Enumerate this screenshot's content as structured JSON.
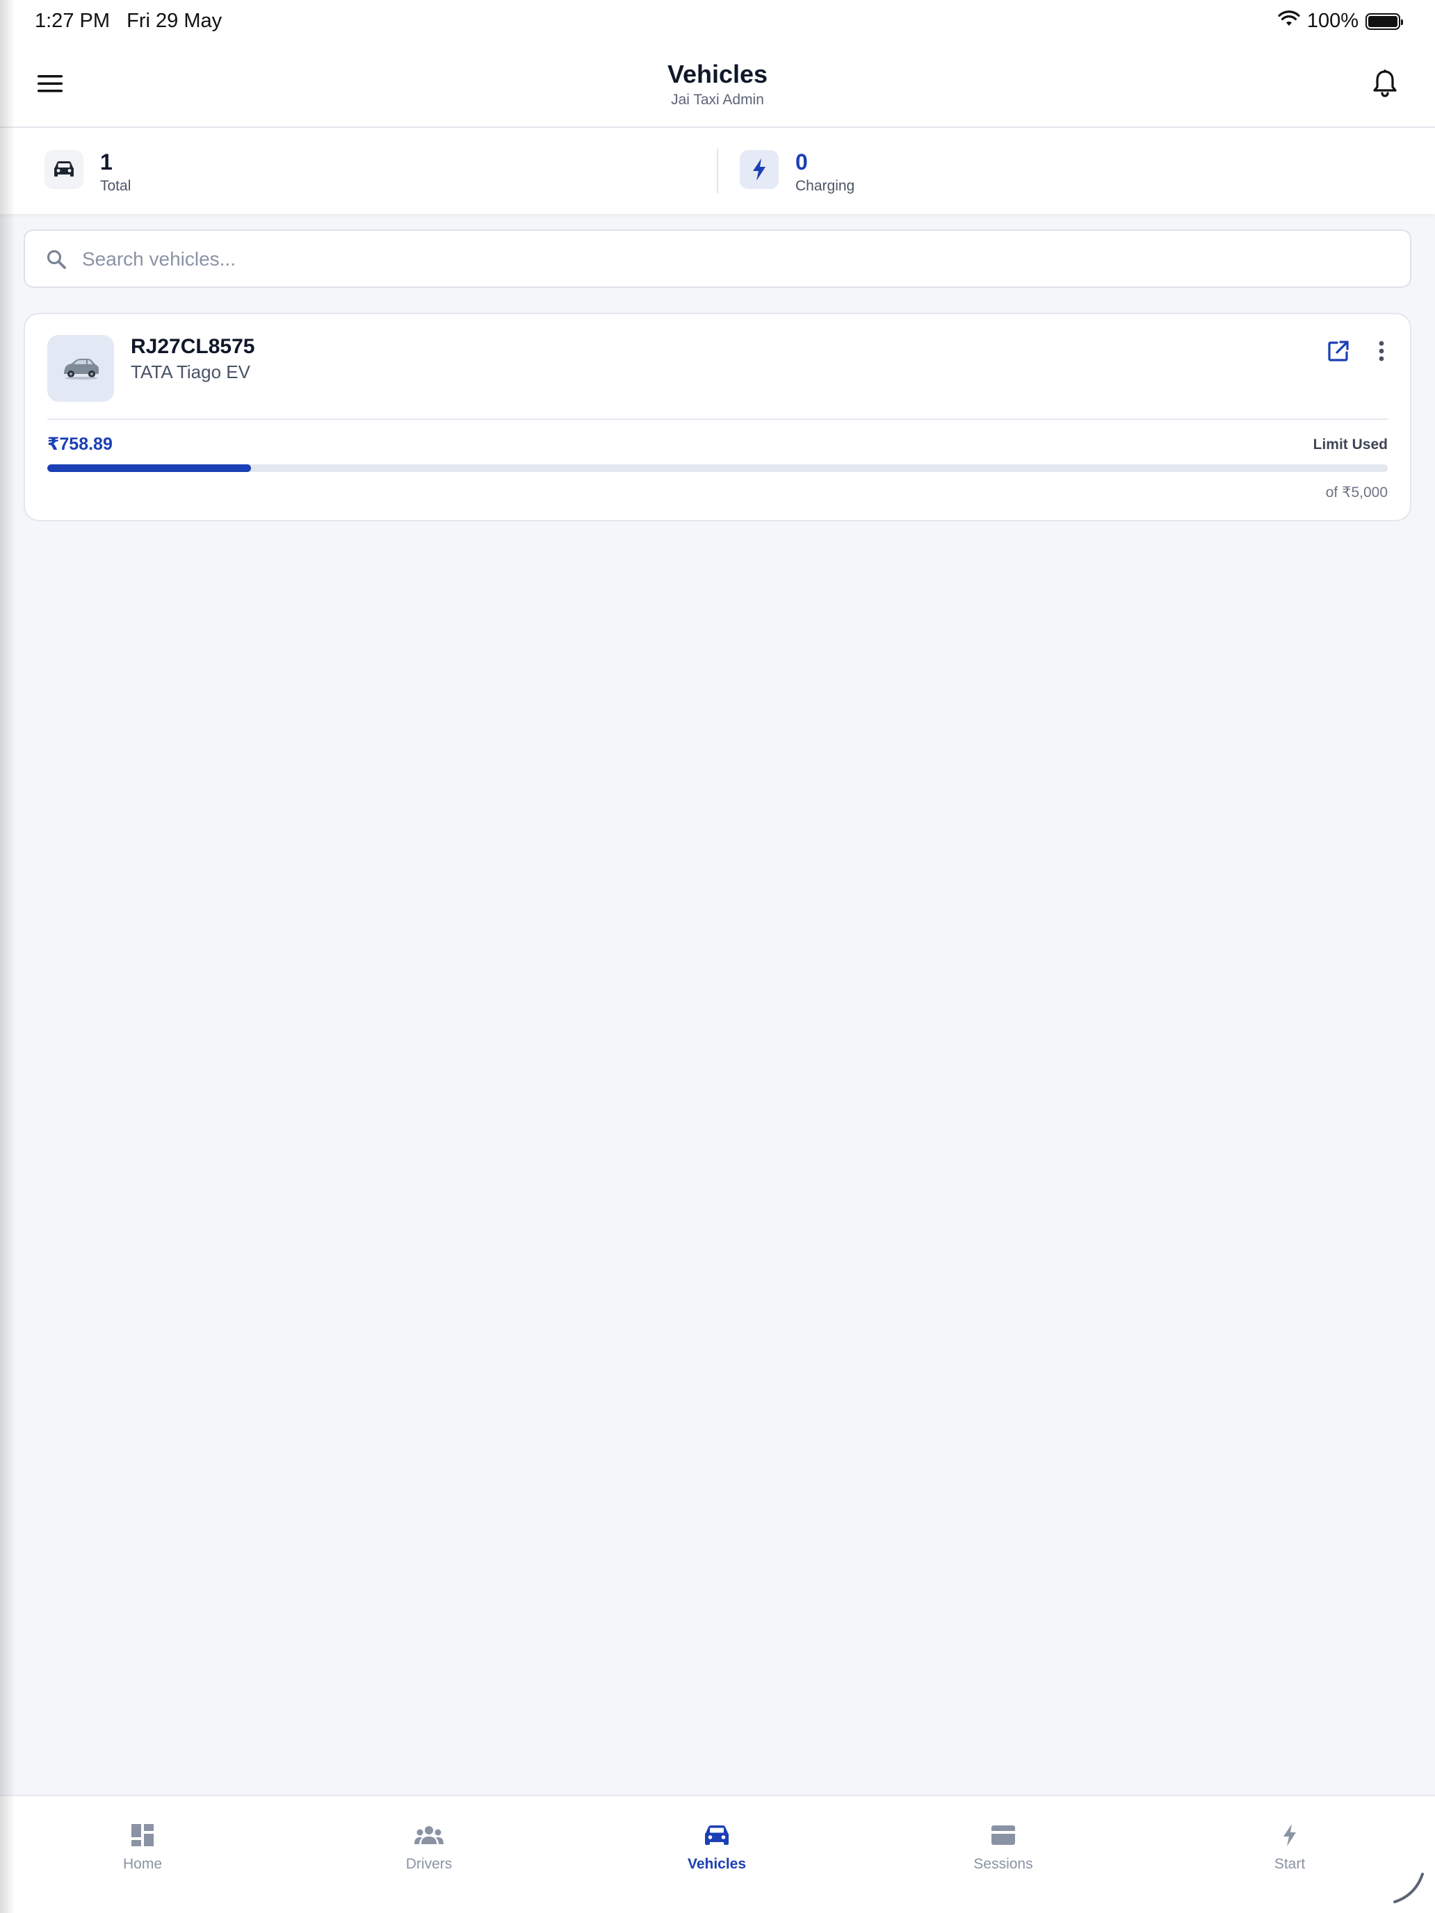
{
  "status_bar": {
    "time": "1:27 PM",
    "date": "Fri 29 May",
    "battery": "100%"
  },
  "header": {
    "title": "Vehicles",
    "subtitle": "Jai Taxi Admin"
  },
  "stats": {
    "total": {
      "value": "1",
      "label": "Total",
      "icon": "car-icon"
    },
    "charging": {
      "value": "0",
      "label": "Charging",
      "icon": "bolt-icon"
    }
  },
  "search": {
    "placeholder": "Search vehicles..."
  },
  "vehicles": [
    {
      "plate": "RJ27CL8575",
      "model": "TATA Tiago EV",
      "amount_used": "₹758.89",
      "limit_label": "Limit Used",
      "limit_total": "of ₹5,000",
      "used_fraction": 0.152
    }
  ],
  "nav": {
    "items": [
      {
        "label": "Home",
        "icon": "dashboard-icon"
      },
      {
        "label": "Drivers",
        "icon": "people-icon"
      },
      {
        "label": "Vehicles",
        "icon": "car-icon"
      },
      {
        "label": "Sessions",
        "icon": "card-icon"
      },
      {
        "label": "Start",
        "icon": "bolt-icon"
      }
    ],
    "active": "Vehicles"
  },
  "colors": {
    "accent": "#1b3fb5",
    "background": "#f4f6fa",
    "inactive": "#8a93a4"
  }
}
